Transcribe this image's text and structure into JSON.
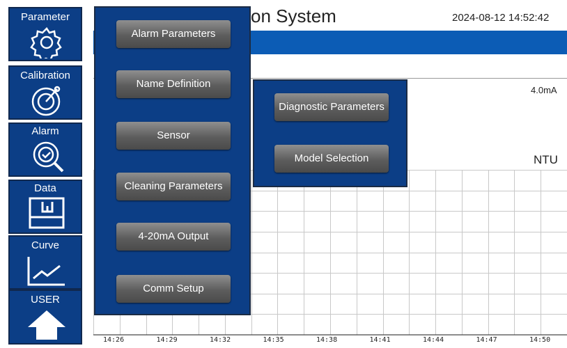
{
  "header": {
    "title_partial": "on System",
    "datetime": "2024-08-12 14:52:42"
  },
  "sidebar": {
    "items": [
      {
        "label": "Parameter",
        "icon": "gear-icon"
      },
      {
        "label": "Calibration",
        "icon": "calibration-dial-icon"
      },
      {
        "label": "Alarm",
        "icon": "alarm-magnifier-icon"
      },
      {
        "label": "Data",
        "icon": "data-folder-icon"
      },
      {
        "label": "Curve",
        "icon": "curve-chart-icon"
      },
      {
        "label": "USER",
        "icon": "home-icon"
      }
    ]
  },
  "display": {
    "current_output": "4.0mA",
    "unit": "NTU"
  },
  "parameter_menu": {
    "items": [
      "Alarm Parameters",
      "Name Definition",
      "Sensor",
      "Cleaning Parameters",
      "4-20mA Output",
      "Comm Setup"
    ]
  },
  "submenu": {
    "items": [
      "Diagnostic Parameters",
      "Model Selection"
    ]
  },
  "chart": {
    "x_ticks": [
      "14:26",
      "14:29",
      "14:32",
      "14:35",
      "14:38",
      "14:41",
      "14:44",
      "14:47",
      "14:50"
    ]
  },
  "colors": {
    "panel_blue": "#0c3e86",
    "bar_blue": "#0c5cb5",
    "button_gray": "#5d5d5d"
  }
}
